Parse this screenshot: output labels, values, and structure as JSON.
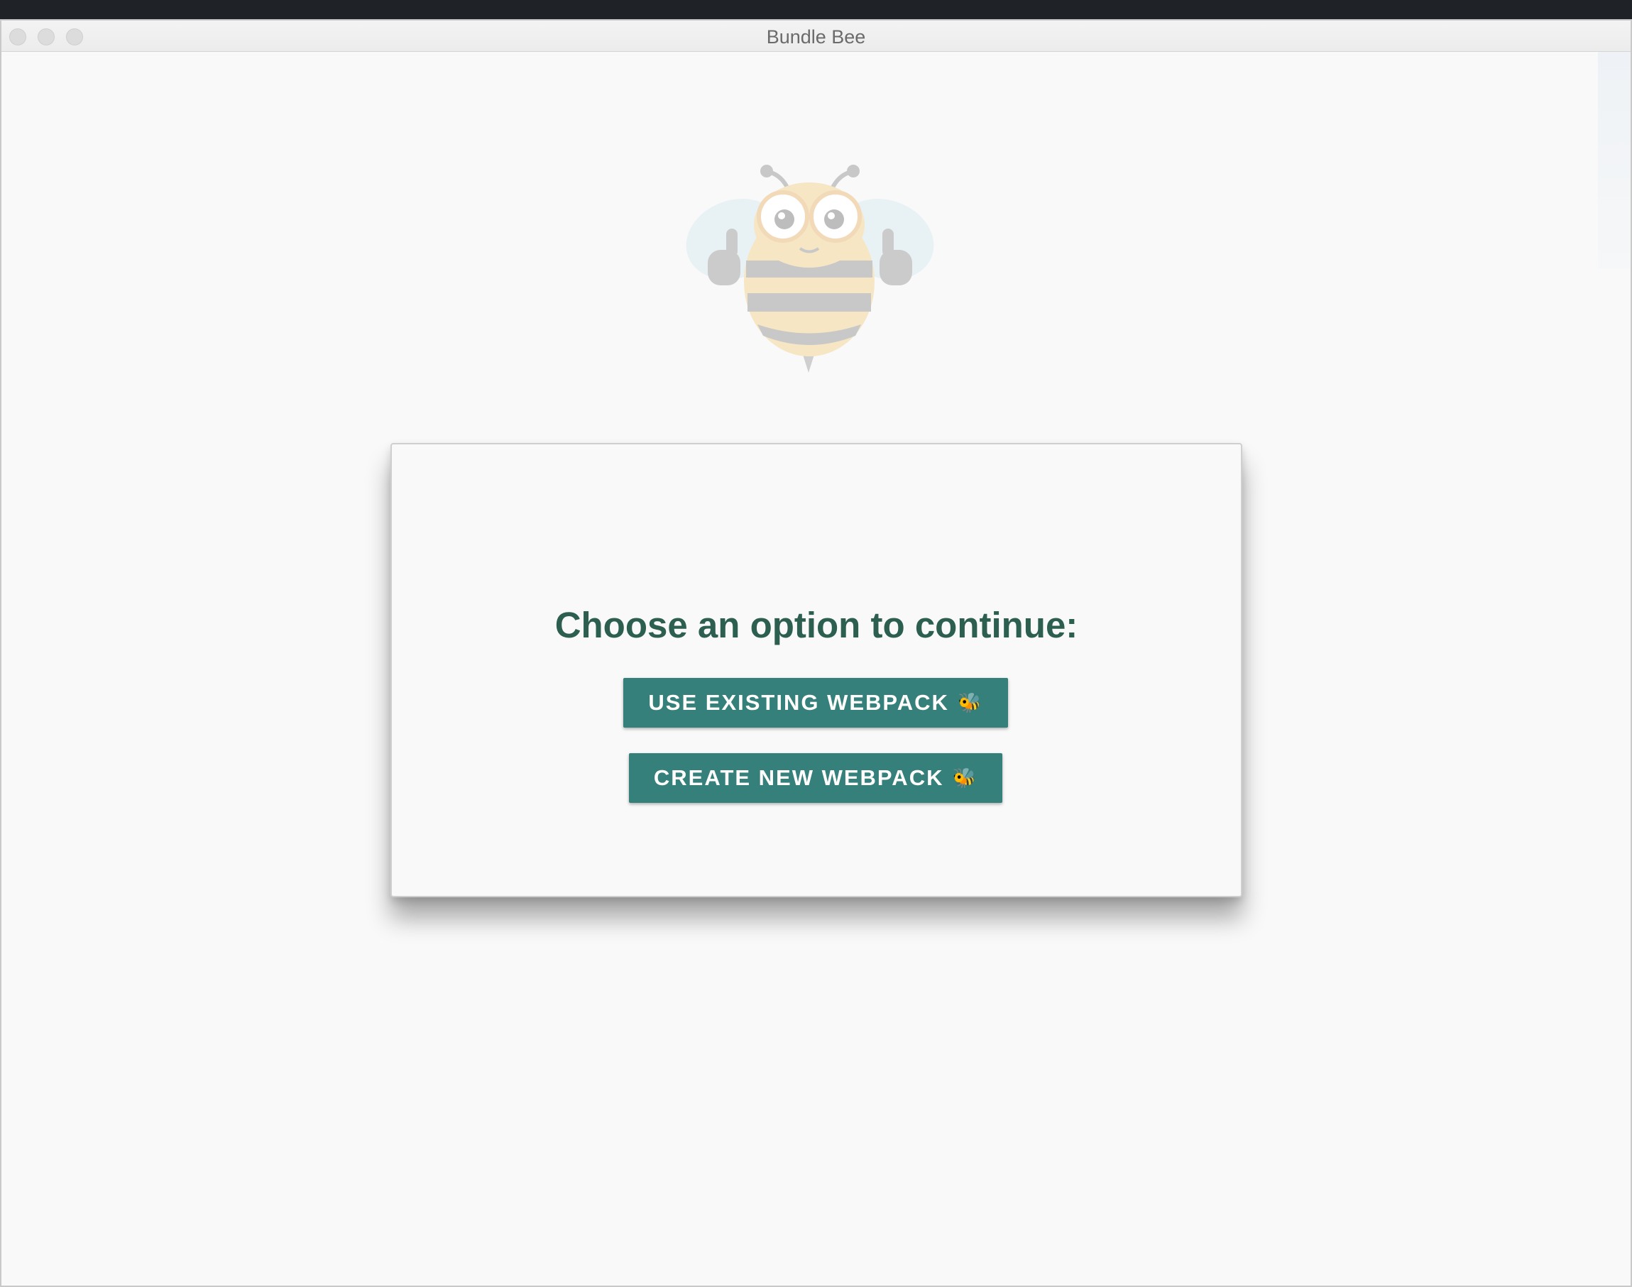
{
  "window": {
    "title": "Bundle Bee"
  },
  "main": {
    "heading": "Choose an option to continue:",
    "buttons": [
      {
        "label": "USE EXISTING WEBPACK",
        "emoji": "🐝"
      },
      {
        "label": "CREATE NEW WEBPACK",
        "emoji": "🐝"
      }
    ]
  },
  "colors": {
    "accent": "#35807a",
    "heading": "#2d5f50",
    "background": "#f9f9f9"
  },
  "icons": {
    "logo": "bee-mascot-icon"
  }
}
